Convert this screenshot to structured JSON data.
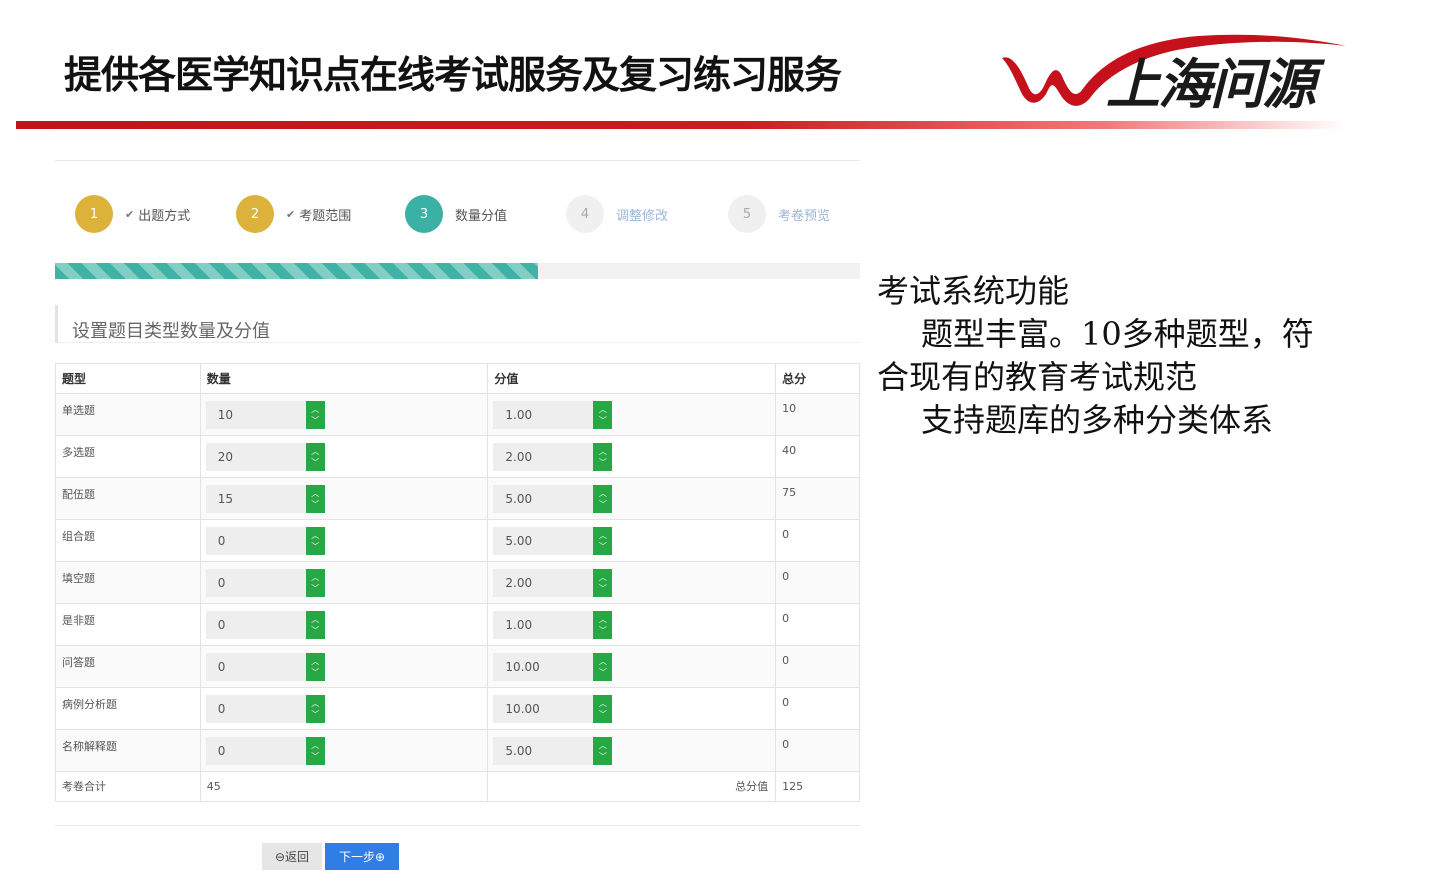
{
  "slide": {
    "title": "提供各医学知识点在线考试服务及复习练习服务",
    "logo_text": "上海问源",
    "colors": {
      "brand_red": "#c4111b"
    }
  },
  "steps": [
    {
      "num": "1",
      "label": "出题方式",
      "state": "done"
    },
    {
      "num": "2",
      "label": "考题范围",
      "state": "done"
    },
    {
      "num": "3",
      "label": "数量分值",
      "state": "active"
    },
    {
      "num": "4",
      "label": "调整修改",
      "state": "todo"
    },
    {
      "num": "5",
      "label": "考卷预览",
      "state": "todo"
    }
  ],
  "progress": {
    "fraction": 0.6
  },
  "section_title": "设置题目类型数量及分值",
  "table": {
    "headers": {
      "type": "题型",
      "count": "数量",
      "score": "分值",
      "total": "总分"
    },
    "rows": [
      {
        "type": "单选题",
        "count": "10",
        "score": "1.00",
        "total": "10"
      },
      {
        "type": "多选题",
        "count": "20",
        "score": "2.00",
        "total": "40"
      },
      {
        "type": "配伍题",
        "count": "15",
        "score": "5.00",
        "total": "75"
      },
      {
        "type": "组合题",
        "count": "0",
        "score": "5.00",
        "total": "0"
      },
      {
        "type": "填空题",
        "count": "0",
        "score": "2.00",
        "total": "0"
      },
      {
        "type": "是非题",
        "count": "0",
        "score": "1.00",
        "total": "0"
      },
      {
        "type": "问答题",
        "count": "0",
        "score": "10.00",
        "total": "0"
      },
      {
        "type": "病例分析题",
        "count": "0",
        "score": "10.00",
        "total": "0"
      },
      {
        "type": "名称解释题",
        "count": "0",
        "score": "5.00",
        "total": "0"
      }
    ],
    "summary": {
      "label": "考卷合计",
      "count": "45",
      "score_label": "总分值",
      "score": "125"
    }
  },
  "buttons": {
    "back": "返回",
    "next": "下一步"
  },
  "description": {
    "line1": "考试系统功能",
    "line2": "题型丰富。10多种题型，符",
    "line3": "合现有的教育考试规范",
    "line4": "支持题库的多种分类体系"
  }
}
